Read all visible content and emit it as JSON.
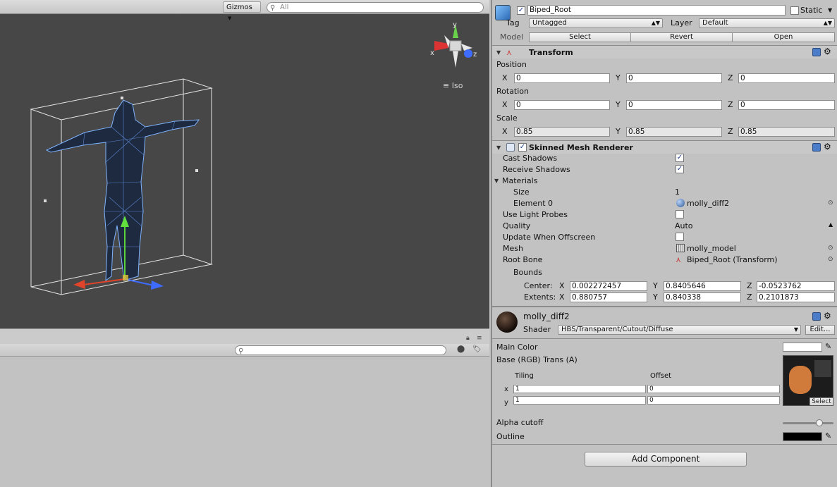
{
  "scene": {
    "gizmos_label": "Gizmos",
    "search_placeholder": "All",
    "projection_label": "Iso",
    "axis_labels": {
      "x": "x",
      "y": "y",
      "z": "z"
    }
  },
  "project": {
    "search_placeholder": ""
  },
  "inspector": {
    "object_name": "Biped_Root",
    "static_label": "Static",
    "tag_label": "Tag",
    "tag_value": "Untagged",
    "layer_label": "Layer",
    "layer_value": "Default",
    "model_label": "Model",
    "model_buttons": [
      "Select",
      "Revert",
      "Open"
    ],
    "transform": {
      "title": "Transform",
      "position_label": "Position",
      "rotation_label": "Rotation",
      "scale_label": "Scale",
      "axes": [
        "X",
        "Y",
        "Z"
      ],
      "position": [
        "0",
        "0",
        "0"
      ],
      "rotation": [
        "0",
        "0",
        "0"
      ],
      "scale": [
        "0.85",
        "0.85",
        "0.85"
      ]
    },
    "renderer": {
      "title": "Skinned Mesh Renderer",
      "cast_shadows_label": "Cast Shadows",
      "cast_shadows": true,
      "receive_shadows_label": "Receive Shadows",
      "receive_shadows": true,
      "materials_label": "Materials",
      "size_label": "Size",
      "size_value": "1",
      "element0_label": "Element 0",
      "element0_value": "molly_diff2",
      "light_probes_label": "Use Light Probes",
      "quality_label": "Quality",
      "quality_value": "Auto",
      "offscreen_label": "Update When Offscreen",
      "mesh_label": "Mesh",
      "mesh_value": "molly_model",
      "root_bone_label": "Root Bone",
      "root_bone_value": "Biped_Root (Transform)",
      "bounds_label": "Bounds",
      "center_label": "Center:",
      "extents_label": "Extents:",
      "center": [
        "0.002272457",
        "0.8405646",
        "-0.0523762"
      ],
      "extents": [
        "0.880757",
        "0.840338",
        "0.2101873"
      ]
    },
    "material": {
      "name": "molly_diff2",
      "shader_label": "Shader",
      "shader_value": "HBS/Transparent/Cutout/Diffuse",
      "edit_label": "Edit...",
      "main_color_label": "Main Color",
      "main_color": "#ffffff",
      "base_label": "Base (RGB) Trans (A)",
      "tiling_label": "Tiling",
      "offset_label": "Offset",
      "row_x": "x",
      "row_y": "y",
      "tiling": [
        "1",
        "1"
      ],
      "offset": [
        "0",
        "0"
      ],
      "select_label": "Select",
      "alpha_label": "Alpha cutoff",
      "alpha_value": 0.72,
      "outline_label": "Outline",
      "outline_color": "#000000"
    },
    "add_component_label": "Add Component"
  }
}
